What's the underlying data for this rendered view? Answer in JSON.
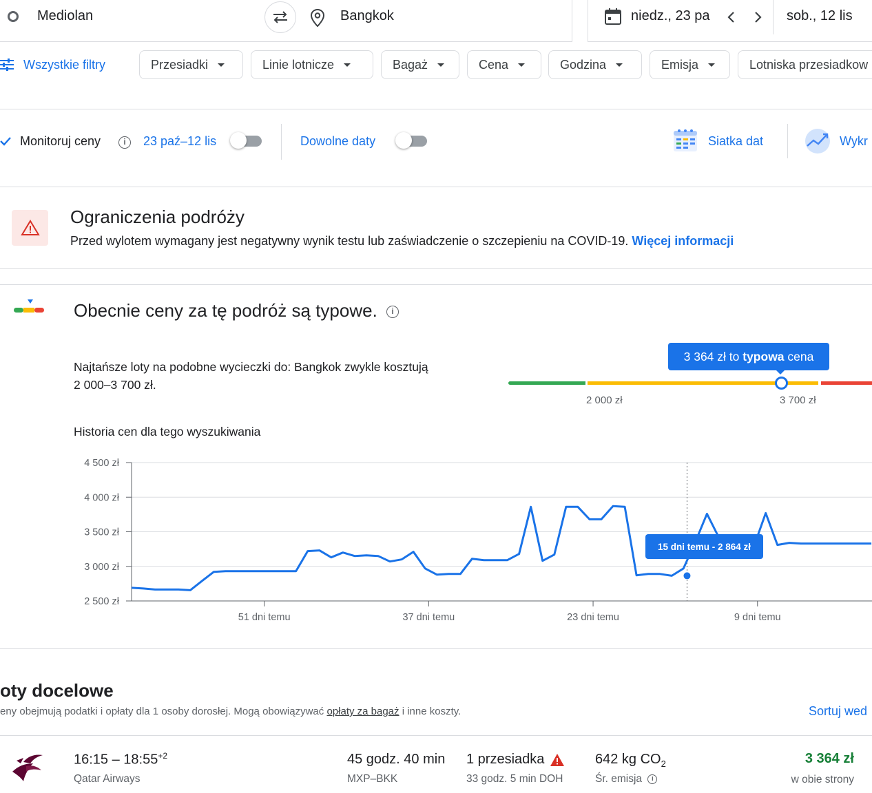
{
  "search": {
    "origin": "Mediolan",
    "destination": "Bangkok",
    "depart_date": "niedz., 23 pa",
    "return_date": "sob., 12 lis"
  },
  "filters": {
    "all_filters": "Wszystkie filtry",
    "chips": [
      "Przesiadki",
      "Linie lotnicze",
      "Bagaż",
      "Cena",
      "Godzina",
      "Emisja",
      "Lotniska przesiadkow"
    ]
  },
  "tools": {
    "monitor_label": "Monitoruj ceny",
    "monitor_range": "23 paź–12 lis",
    "any_dates": "Dowolne daty",
    "date_grid": "Siatka dat",
    "chart_link": "Wykr"
  },
  "restrictions": {
    "title": "Ograniczenia podróży",
    "text": "Przed wylotem wymagany jest negatywny wynik testu lub zaświadczenie o szczepieniu na COVID-19.",
    "link": "Więcej informacji"
  },
  "insights": {
    "title": "Obecnie ceny za tę podróż są typowe.",
    "description_line1": "Najtańsze loty na podobne wycieczki do: Bangkok zwykle kosztują",
    "description_line2": "2 000–3 700 zł.",
    "badge_price": "3 364 zł to",
    "badge_bold": "typowa",
    "badge_suffix": "cena",
    "range_low": "2 000 zł",
    "range_high": "3 700 zł",
    "history_title": "Historia cen dla tego wyszukiwania",
    "hover_label": "15 dni temu - 2 864 zł"
  },
  "colors": {
    "accent": "#1a73e8",
    "green": "#34a853",
    "yellow": "#fbbc04",
    "red": "#ea4335",
    "price_green": "#188038"
  },
  "chart_data": {
    "type": "line",
    "title": "Historia cen dla tego wyszukiwania",
    "xlabel": "",
    "ylabel": "",
    "y_ticks": [
      "4 500 zł",
      "4 000 zł",
      "3 500 zł",
      "3 000 zł",
      "2 500 zł"
    ],
    "y_tick_values": [
      4500,
      4000,
      3500,
      3000,
      2500
    ],
    "ylim": [
      2500,
      4500
    ],
    "x_ticks": [
      "51 dni temu",
      "37 dni temu",
      "23 dni temu",
      "9 dni temu"
    ],
    "x_tick_values": [
      51,
      37,
      23,
      9
    ],
    "xlim": [
      62.3,
      -0.75
    ],
    "hover_point": {
      "x": 15,
      "y": 2864
    },
    "series": [
      {
        "x": [
          62.3,
          61.3,
          60.3,
          59.3,
          58.3,
          57.3,
          56.3,
          55.3,
          54.3,
          53.3,
          52.3,
          51.3,
          50.3,
          49.3,
          48.3,
          47.3,
          46.3,
          45.3,
          44.3,
          43.3,
          42.3,
          41.3,
          40.3,
          39.3,
          38.3,
          37.3,
          36.3,
          35.3,
          34.3,
          33.3,
          32.3,
          31.3,
          30.3,
          29.3,
          28.3,
          27.3,
          26.3,
          25.3,
          24.3,
          23.3,
          22.3,
          21.3,
          20.3,
          19.3,
          18.3,
          17.3,
          16.3,
          15.3,
          14.3,
          13.3,
          12.3,
          11.3,
          10.3,
          9.3,
          8.3,
          7.3,
          6.3,
          5.3,
          4.3,
          3.3,
          2.3,
          1.3,
          0.3,
          -0.7
        ],
        "y": [
          2690,
          2680,
          2665,
          2665,
          2665,
          2655,
          2790,
          2920,
          2930,
          2930,
          2930,
          2930,
          2930,
          2930,
          2930,
          3220,
          3230,
          3130,
          3200,
          3150,
          3160,
          3150,
          3070,
          3100,
          3210,
          2970,
          2880,
          2890,
          2890,
          3110,
          3090,
          3090,
          3090,
          3180,
          3860,
          3080,
          3170,
          3860,
          3860,
          3680,
          3680,
          3870,
          3860,
          2870,
          2890,
          2890,
          2864,
          2970,
          3350,
          3760,
          3420,
          3290,
          3290,
          3290,
          3770,
          3310,
          3340,
          3330,
          3330,
          3330,
          3330,
          3330,
          3330,
          3330
        ]
      }
    ]
  },
  "results": {
    "title": "oty docelowe",
    "note_prefix": "eny obejmują podatki i opłaty dla 1 osoby dorosłej. Mogą obowiązywać",
    "note_link": "opłaty za bagaż",
    "note_suffix": "i inne koszty.",
    "sort": "Sortuj wed",
    "flights": [
      {
        "times": "16:15 – 18:55",
        "plus_days": "+2",
        "airline": "Qatar Airways",
        "duration": "45 godz. 40 min",
        "route": "MXP–BKK",
        "stops": "1 przesiadka",
        "layover": "33 godz. 5 min DOH",
        "co2_value": "642 kg CO",
        "co2_sub": "2",
        "emission_label": "Śr. emisja",
        "price": "3 364 zł",
        "trip_type": "w obie strony"
      }
    ]
  }
}
